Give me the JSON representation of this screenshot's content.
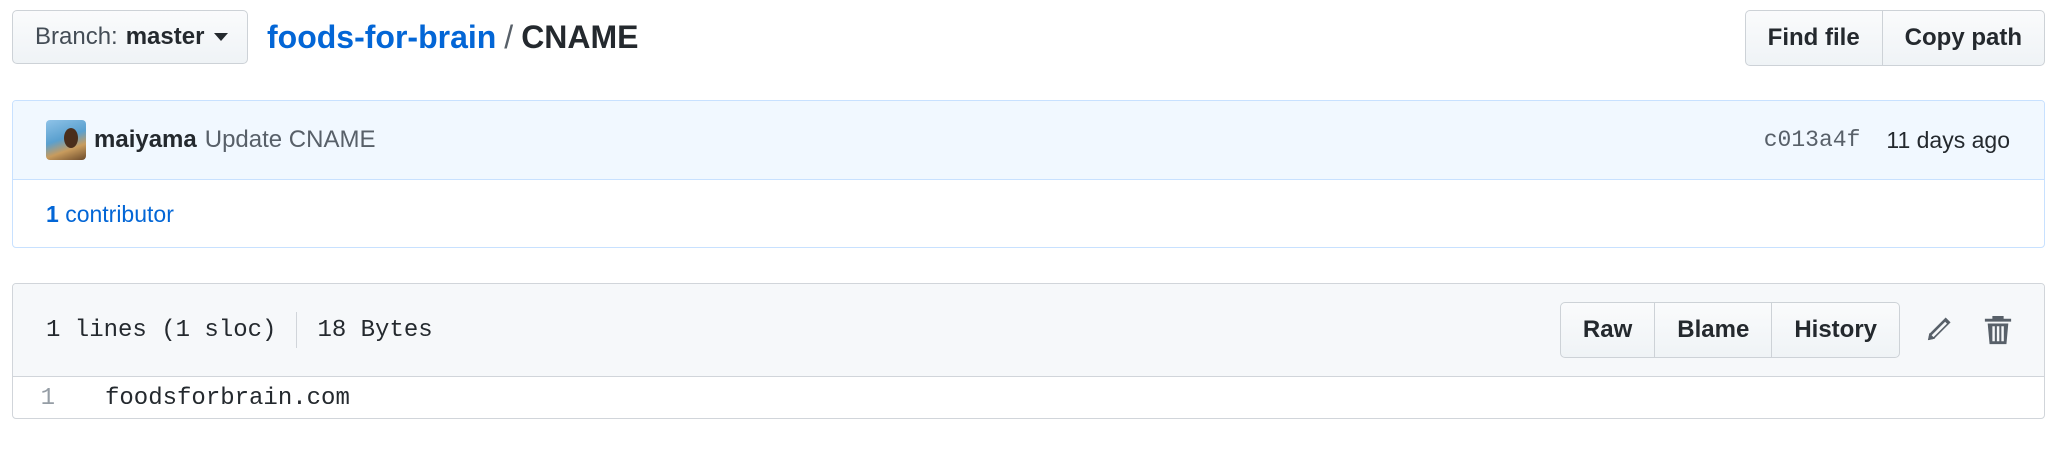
{
  "branch": {
    "label": "Branch:",
    "value": "master"
  },
  "breadcrumb": {
    "repo": "foods-for-brain",
    "separator": "/",
    "file": "CNAME"
  },
  "file_nav": {
    "find_file": "Find file",
    "copy_path": "Copy path"
  },
  "commit": {
    "author": "maiyama",
    "message": "Update CNAME",
    "sha": "c013a4f",
    "time": "11 days ago"
  },
  "contributors": {
    "count": "1",
    "label": "contributor"
  },
  "file": {
    "lines": "1 lines (1 sloc)",
    "size": "18 Bytes",
    "actions": {
      "raw": "Raw",
      "blame": "Blame",
      "history": "History"
    }
  },
  "code_lines": [
    {
      "number": "1",
      "text": "foodsforbrain.com"
    }
  ],
  "icons": {
    "edit": "pencil-icon",
    "delete": "trash-icon"
  },
  "colors": {
    "link": "#0366d6",
    "commit_bg": "#f1f8ff",
    "header_bg": "#f6f8fa"
  }
}
